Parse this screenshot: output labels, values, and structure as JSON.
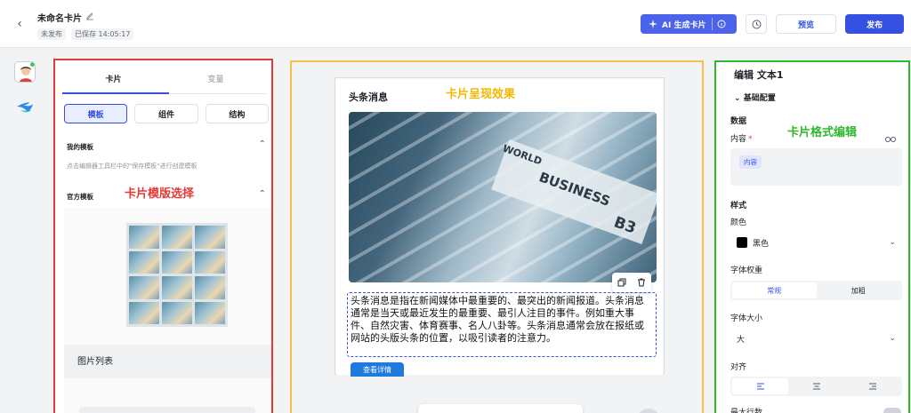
{
  "header": {
    "title": "未命名卡片",
    "status_unpublished": "未发布",
    "status_saved": "已保存 14:05:17",
    "ai_button": "AI 生成卡片",
    "preview_button": "预览",
    "publish_button": "发布"
  },
  "left_panel": {
    "tabs": [
      "卡片",
      "变量"
    ],
    "segments": [
      "模板",
      "组件",
      "结构"
    ],
    "my_templates_title": "我的模板",
    "my_templates_hint": "点击编辑器工具栏中的\"保存模板\"进行创建模板",
    "official_templates_title": "官方模板",
    "annotation": "卡片模版选择",
    "template_label": "图片列表"
  },
  "canvas": {
    "annotation": "卡片呈现效果",
    "card_title": "头条消息",
    "image_words": [
      "WORLD",
      "BUSINESS",
      "B3"
    ],
    "body_text": "头条消息是指在新闻媒体中最重要的、最突出的新闻报道。头条消息通常是当天或最近发生的最重要、最引人注目的事件。例如重大事件、自然灾害、体育赛事、名人八卦等。头条消息通常会放在报纸或网站的头版头条的位置，以吸引读者的注意力。",
    "button_text": "查看详情"
  },
  "right_panel": {
    "title": "编辑 文本1",
    "section_basic": "基础配置",
    "annotation": "卡片格式编辑",
    "data_title": "数据",
    "content_label": "内容",
    "content_required": "*",
    "content_tag": "内容",
    "style_title": "样式",
    "color_label": "颜色",
    "color_value": "黑色",
    "weight_label": "字体权重",
    "weight_options": [
      "常规",
      "加粗"
    ],
    "size_label": "字体大小",
    "size_value": "大",
    "align_label": "对齐",
    "max_lines_label": "最大行数"
  },
  "colors": {
    "primary": "#3451e1",
    "annotation_red": "#e53935",
    "annotation_yellow": "#f5b800",
    "annotation_green": "#2eb82e"
  }
}
